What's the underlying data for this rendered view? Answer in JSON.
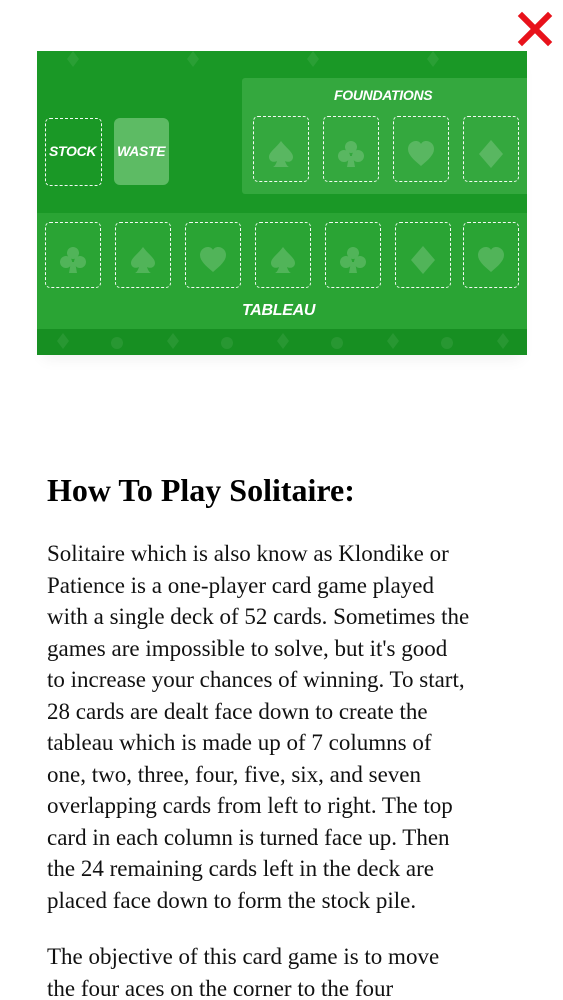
{
  "close_button": {
    "icon": "close-icon",
    "color": "#e8121b"
  },
  "board": {
    "background": "#1f9e2b",
    "labels": {
      "foundations": "FOUNDATIONS",
      "stock": "STOCK",
      "waste": "WASTE",
      "tableau": "TABLEAU"
    },
    "foundation_slots": [
      "spade-icon",
      "club-icon",
      "heart-icon",
      "diamond-icon"
    ],
    "tableau_slots": [
      "club-icon",
      "spade-icon",
      "heart-icon",
      "spade-icon",
      "club-icon",
      "diamond-icon",
      "heart-icon"
    ]
  },
  "article": {
    "title": "How To Play Solitaire:",
    "paragraph1_lines": [
      "Solitaire which is also know as Klondike or",
      "Patience is a one-player card game played",
      "with a single deck of 52 cards. Sometimes the",
      "games are impossible to solve, but it's good",
      "to increase your chances of winning. To start,",
      "28 cards are dealt face down to create the",
      "tableau which is made up of 7 columns of",
      "one, two, three, four, five, six, and seven",
      "overlapping cards from left to right. The top",
      "card in each column is turned face up. Then",
      "the 24 remaining cards left in the deck are",
      "placed face down to form the stock pile."
    ],
    "paragraph2_lines": [
      "The objective of this card game is to move",
      "the four aces on the corner to the four"
    ]
  }
}
